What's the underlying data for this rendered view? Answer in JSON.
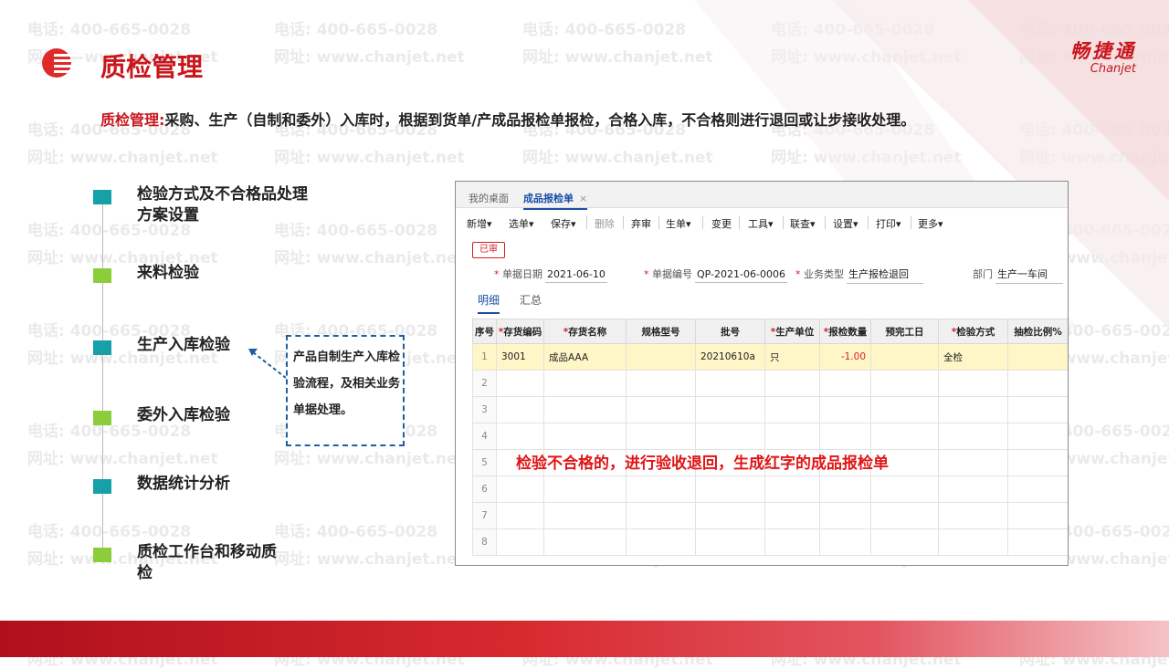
{
  "watermark": {
    "phone": "电话: 400-665-0028",
    "site": "网址: www.chanjet.net"
  },
  "header": {
    "title": "质检管理",
    "brand_cn": "畅捷通",
    "brand_en": "Chanjet"
  },
  "description": {
    "keyword": "质检管理:",
    "text": "采购、生产（自制和委外）入库时，根据到货单/产成品报检单报检，合格入库，不合格则进行退回或让步接收处理。"
  },
  "steps": [
    {
      "label": "检验方式及不合格品处理方案设置",
      "color": "teal"
    },
    {
      "label": "来料检验",
      "color": "green"
    },
    {
      "label": "生产入库检验",
      "color": "teal"
    },
    {
      "label": "委外入库检验",
      "color": "green"
    },
    {
      "label": "数据统计分析",
      "color": "teal"
    },
    {
      "label": "质检工作台和移动质检",
      "color": "green"
    }
  ],
  "callout": {
    "text": "产品自制生产入库检验流程，及相关业务单据处理。"
  },
  "app": {
    "tabs": {
      "home": "我的桌面",
      "active": "成品报检单",
      "close": "×"
    },
    "toolbar": {
      "new": "新增",
      "select": "选单",
      "save": "保存",
      "delete": "删除",
      "unaudit": "弃审",
      "gen": "生单",
      "change": "变更",
      "tools": "工具",
      "link": "联查",
      "settings": "设置",
      "print": "打印",
      "more": "更多"
    },
    "status_badge": "已审",
    "form": {
      "date_label": "单据日期",
      "date_value": "2021-06-10",
      "no_label": "单据编号",
      "no_value": "QP-2021-06-0006",
      "biz_label": "业务类型",
      "biz_value": "生产报检退回",
      "dept_label": "部门",
      "dept_value": "生产一车间"
    },
    "subtabs": {
      "detail": "明细",
      "summary": "汇总"
    },
    "columns": [
      "序号",
      "存货编码",
      "存货名称",
      "规格型号",
      "批号",
      "生产单位",
      "报检数量",
      "预完工日",
      "检验方式",
      "抽检比例%"
    ],
    "rows": [
      {
        "idx": "1",
        "code": "3001",
        "name": "成品AAA",
        "spec": "",
        "batch": "20210610a",
        "unit": "只",
        "qty": "-1.00",
        "date": "",
        "method": "全检",
        "ratio": ""
      },
      {
        "idx": "2"
      },
      {
        "idx": "3"
      },
      {
        "idx": "4"
      },
      {
        "idx": "5"
      },
      {
        "idx": "6"
      },
      {
        "idx": "7"
      },
      {
        "idx": "8"
      }
    ],
    "overlay_note": "检验不合格的，进行验收退回，生成红字的成品报检单"
  }
}
